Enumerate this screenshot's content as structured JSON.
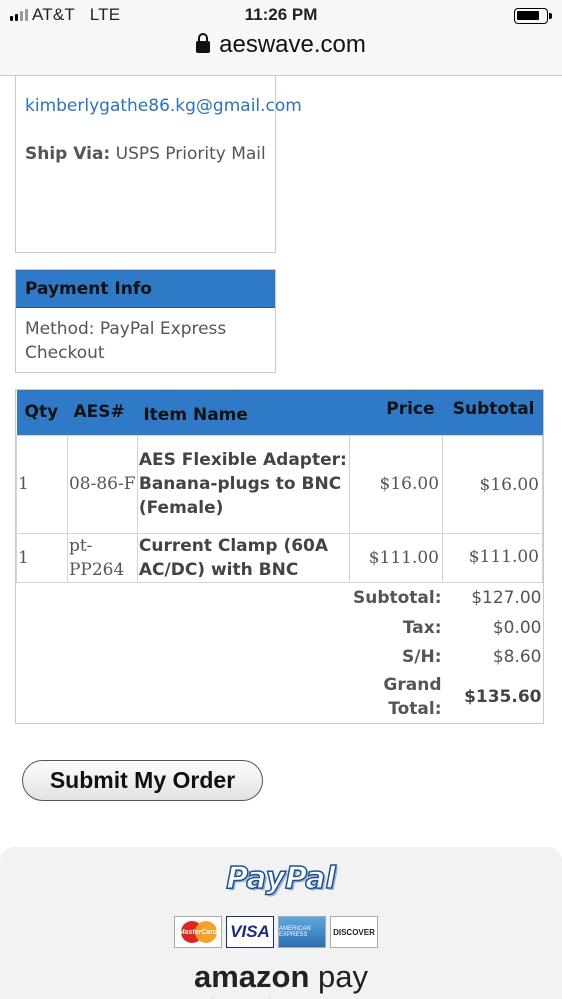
{
  "status_bar": {
    "carrier": "AT&T",
    "network": "LTE",
    "time": "11:26 PM"
  },
  "browser": {
    "url": "aeswave.com"
  },
  "shipping": {
    "email": "kimberlygathe86.kg@gmail.com",
    "ship_via_label": "Ship Via:",
    "ship_via_value": "USPS Priority Mail"
  },
  "payment": {
    "heading": "Payment Info",
    "method": "Method: PayPal Express Checkout"
  },
  "order": {
    "headers": {
      "qty": "Qty",
      "aes": "AES#",
      "name": "Item Name",
      "price": "Price",
      "subtotal": "Subtotal"
    },
    "rows": [
      {
        "qty": "1",
        "aes": "08-86-F",
        "name": "AES Flexible Adapter: Banana-plugs to BNC (Female)",
        "price": "$16.00",
        "subtotal": "$16.00"
      },
      {
        "qty": "1",
        "aes": "pt-PP264",
        "name": "Current Clamp (60A AC/DC) with BNC",
        "price": "$111.00",
        "subtotal": "$111.00"
      }
    ],
    "totals": {
      "subtotal_label": "Subtotal:",
      "subtotal": "$127.00",
      "tax_label": "Tax:",
      "tax": "$0.00",
      "sh_label": "S/H:",
      "sh": "$8.60",
      "grand_label": "Grand Total:",
      "grand": "$135.60"
    }
  },
  "submit_label": "Submit My Order",
  "footer": {
    "paypal": "PayPal",
    "cards": [
      "mastercard",
      "visa",
      "american-express",
      "discover"
    ],
    "mastercard_text": "MasterCard",
    "visa_text": "VISA",
    "amex_text": "AMERICAN EXPRESS",
    "discover_text": "DISCOVER",
    "amazon_word": "amazon",
    "amazon_pay": "pay"
  }
}
